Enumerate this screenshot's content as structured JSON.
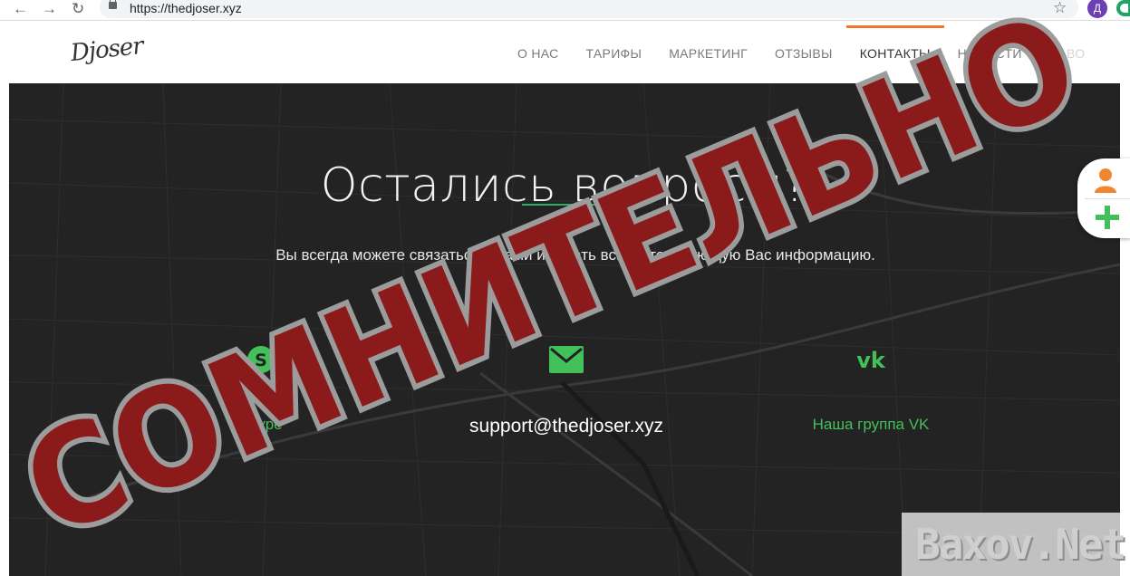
{
  "browser": {
    "back_icon": "arrow-left-icon",
    "forward_icon": "arrow-right-icon",
    "reload_icon": "reload-icon",
    "url": "https://thedjoser.xyz",
    "avatar_letter": "Д"
  },
  "site": {
    "logo": "Djoser",
    "menu": [
      {
        "label": "О НАС"
      },
      {
        "label": "ТАРИФЫ"
      },
      {
        "label": "МАРКЕТИНГ"
      },
      {
        "label": "ОТЗЫВЫ"
      },
      {
        "label": "КОНТАКТЫ",
        "active": true
      },
      {
        "label": "НОВОСТИ"
      },
      {
        "label": "ЧАВО"
      }
    ],
    "accent_color": "#f0762e"
  },
  "hero": {
    "title": "Остались вопросы?",
    "subtitle": "Вы всегда можете связаться с нами и узнать всю интересующую Вас информацию.",
    "contacts": {
      "skype_label": "Skype",
      "email": "support@thedjoser.xyz",
      "vk_label": "Наша группа VK"
    },
    "green_color": "#42c05a"
  },
  "overlay": {
    "stamp_text": "СОМНИТЕЛЬНО",
    "stamp_color": "#8b1a1a",
    "brand": "Baxov.Net"
  }
}
